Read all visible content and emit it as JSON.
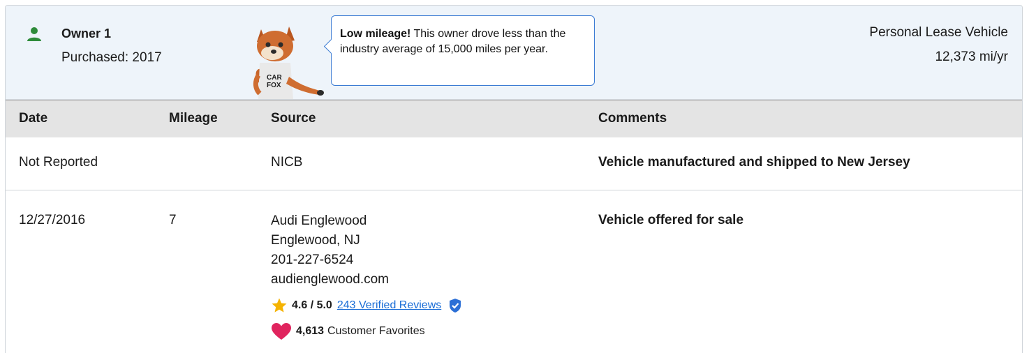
{
  "owner": {
    "title": "Owner 1",
    "purchased": "Purchased: 2017",
    "tooltip_bold": "Low mileage!",
    "tooltip_text": " This owner drove less than the industry average of 15,000 miles per year.",
    "vehicle_type": "Personal Lease Vehicle",
    "miles_per_year": "12,373 mi/yr",
    "mascot_shirt": "CAR FOX"
  },
  "table": {
    "headers": [
      "Date",
      "Mileage",
      "Source",
      "Comments"
    ],
    "rows": [
      {
        "date": "Not Reported",
        "mileage": "",
        "source": "NICB",
        "comment": "Vehicle manufactured and shipped to New Jersey"
      },
      {
        "date": "12/27/2016",
        "mileage": "7",
        "source_name": "Audi Englewood",
        "source_city": "Englewood, NJ",
        "source_phone": "201-227-6524",
        "source_site": "audienglewood.com",
        "rating": "4.6 / 5.0",
        "reviews": "243 Verified Reviews",
        "favorites_count": "4,613",
        "favorites_label": "Customer Favorites",
        "comment": "Vehicle offered for sale"
      }
    ]
  },
  "colors": {
    "header_bg": "#eef4fa",
    "person_icon": "#2e8b3a",
    "link": "#1a6dd6",
    "star": "#f5b301",
    "heart": "#e0245e",
    "verified": "#2b6fd6"
  },
  "icons": [
    "person-icon",
    "car-fox-mascot",
    "star-icon",
    "verified-badge-icon",
    "heart-icon"
  ]
}
